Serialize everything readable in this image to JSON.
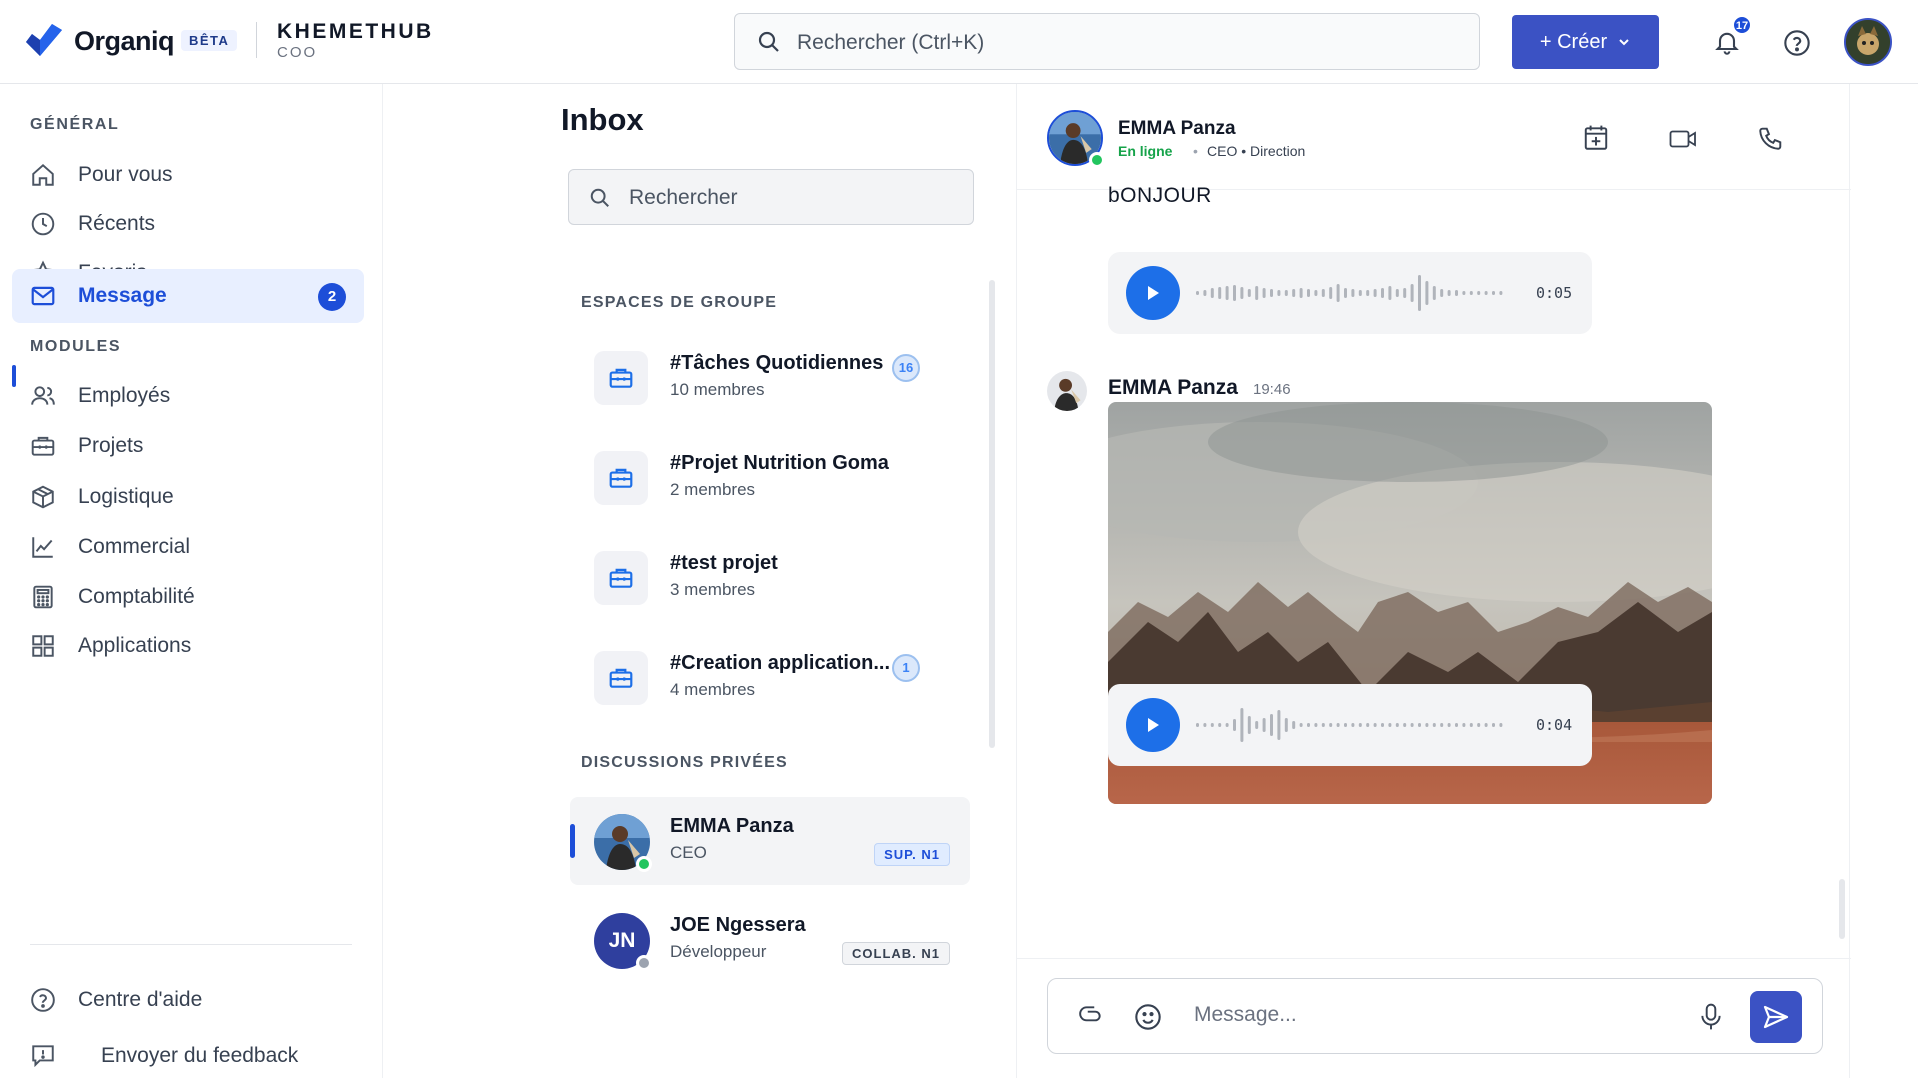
{
  "header": {
    "brand": "Organiq",
    "beta_label": "BÊTA",
    "org_name": "KHEMETHUB",
    "org_role": "COO",
    "search_placeholder": "Rechercher (Ctrl+K)",
    "create_label": "+ Créer",
    "notifications_count": "17",
    "accent": "#3b52c4"
  },
  "sidebar": {
    "general_label": "GÉNÉRAL",
    "general_items": [
      {
        "label": "Pour vous",
        "icon": "home-icon"
      },
      {
        "label": "Récents",
        "icon": "clock-icon"
      },
      {
        "label": "Favoris",
        "icon": "star-icon"
      },
      {
        "label": "Message",
        "icon": "mail-icon",
        "badge": "2",
        "active": true
      }
    ],
    "modules_label": "MODULES",
    "module_items": [
      {
        "label": "Employés",
        "icon": "users-icon"
      },
      {
        "label": "Projets",
        "icon": "briefcase-icon"
      },
      {
        "label": "Logistique",
        "icon": "box-icon"
      },
      {
        "label": "Commercial",
        "icon": "chart-line-icon"
      },
      {
        "label": "Comptabilité",
        "icon": "calculator-icon"
      },
      {
        "label": "Applications",
        "icon": "grid-icon"
      }
    ],
    "help_label": "Centre d'aide",
    "feedback_label": "Envoyer du feedback"
  },
  "inbox": {
    "title": "Inbox",
    "search_placeholder": "Rechercher",
    "group_section_label": "ESPACES DE GROUPE",
    "groups": [
      {
        "name": "#Tâches Quotidiennes",
        "members": "10 membres",
        "count": "16"
      },
      {
        "name": "#Projet Nutrition Goma",
        "members": "2 membres",
        "count": ""
      },
      {
        "name": "#test projet",
        "members": "3 membres",
        "count": ""
      },
      {
        "name": "#Creation application...",
        "members": "4 membres",
        "count": "1"
      }
    ],
    "private_section_label": "DISCUSSIONS PRIVÉES",
    "private": [
      {
        "name": "EMMA Panza",
        "role": "CEO",
        "tag": "SUP. N1",
        "status": "online",
        "active": true
      },
      {
        "name": "JOE Ngessera",
        "role": "Développeur",
        "tag": "COLLAB. N1",
        "initials": "JN",
        "status": "offline"
      }
    ]
  },
  "chat": {
    "contact_name": "EMMA Panza",
    "contact_status": "En ligne",
    "contact_meta": "CEO • Direction",
    "messages": {
      "text": "bONJOUR",
      "audio1_duration": "0:05",
      "sender": "EMMA Panza",
      "time": "19:46",
      "audio2_duration": "0:04"
    },
    "composer_placeholder": "Message..."
  }
}
